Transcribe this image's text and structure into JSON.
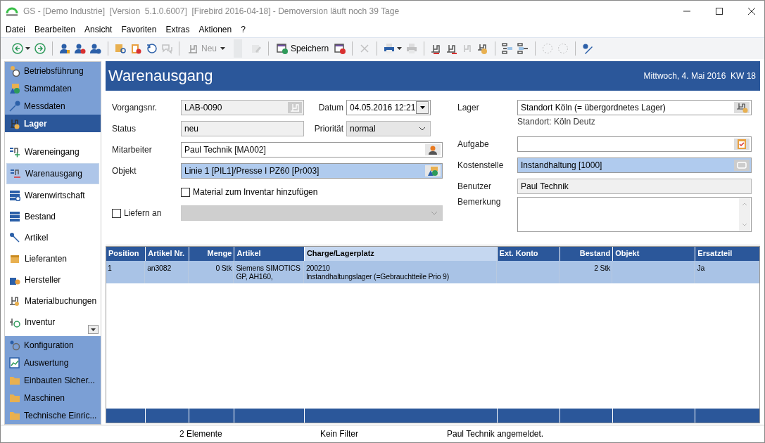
{
  "window": {
    "title": "GS - [Demo Industrie]  [Version  5.1.0.6007]  [Firebird 2016-04-18] - Demoversion läuft noch 39 Tage"
  },
  "menu": [
    "Datei",
    "Bearbeiten",
    "Ansicht",
    "Favoriten",
    "Extras",
    "Aktionen",
    "?"
  ],
  "toolbar": [
    {
      "kind": "icon",
      "disabled": false
    },
    {
      "kind": "caret",
      "disabled": false
    },
    {
      "kind": "icon",
      "disabled": false
    },
    {
      "kind": "separator"
    },
    {
      "kind": "icon",
      "disabled": false
    },
    {
      "kind": "icon",
      "disabled": false
    },
    {
      "kind": "icon",
      "disabled": false
    },
    {
      "kind": "separator"
    },
    {
      "kind": "icon",
      "disabled": false
    },
    {
      "kind": "icon",
      "disabled": false
    },
    {
      "kind": "icon",
      "disabled": false
    },
    {
      "kind": "icon",
      "disabled": true
    },
    {
      "kind": "separator"
    },
    {
      "kind": "button",
      "label": "Neu",
      "disabled": true
    },
    {
      "kind": "caret",
      "disabled": false
    },
    {
      "kind": "gap"
    },
    {
      "kind": "icon",
      "disabled": true
    },
    {
      "kind": "separator"
    },
    {
      "kind": "button",
      "label": "Speichern",
      "disabled": false
    },
    {
      "kind": "icon",
      "disabled": false
    },
    {
      "kind": "separator"
    },
    {
      "kind": "icon",
      "disabled": true
    },
    {
      "kind": "separator"
    },
    {
      "kind": "icon",
      "disabled": false
    },
    {
      "kind": "caret",
      "disabled": false
    },
    {
      "kind": "icon",
      "disabled": true
    },
    {
      "kind": "separator"
    },
    {
      "kind": "icon",
      "disabled": false
    },
    {
      "kind": "icon",
      "disabled": false
    },
    {
      "kind": "icon",
      "disabled": true
    },
    {
      "kind": "icon",
      "disabled": false
    },
    {
      "kind": "separator"
    },
    {
      "kind": "icon",
      "disabled": false
    },
    {
      "kind": "icon",
      "disabled": false
    },
    {
      "kind": "separator"
    },
    {
      "kind": "icon",
      "disabled": true
    },
    {
      "kind": "icon",
      "disabled": true
    },
    {
      "kind": "separator"
    },
    {
      "kind": "icon",
      "disabled": false
    }
  ],
  "sidebar": {
    "groups_top": [
      {
        "label": "Betriebsführung",
        "selected": false
      },
      {
        "label": "Stammdaten",
        "selected": false
      },
      {
        "label": "Messdaten",
        "selected": false
      },
      {
        "label": "Lager",
        "selected": true
      }
    ],
    "items": [
      {
        "label": "Wareneingang",
        "selected": false
      },
      {
        "label": "Warenausgang",
        "selected": true
      },
      {
        "label": "Warenwirtschaft",
        "selected": false
      },
      {
        "label": "Bestand",
        "selected": false
      },
      {
        "label": "Artikel",
        "selected": false
      },
      {
        "label": "Lieferanten",
        "selected": false
      },
      {
        "label": "Hersteller",
        "selected": false
      },
      {
        "label": "Materialbuchungen",
        "selected": false
      },
      {
        "label": "Inventur",
        "selected": false
      }
    ],
    "groups_bottom": [
      {
        "label": "Konfiguration",
        "selected": false
      },
      {
        "label": "Auswertung",
        "selected": false
      },
      {
        "label": "Einbauten Sicher...",
        "selected": false
      },
      {
        "label": "Maschinen",
        "selected": false
      },
      {
        "label": "Technische Einric...",
        "selected": false
      }
    ]
  },
  "header": {
    "title": "Warenausgang",
    "date": "Mittwoch, 4. Mai 2016  KW 18"
  },
  "form": {
    "vorgangsnr": {
      "label": "Vorgangsnr.",
      "value": "LAB-0090",
      "readonly": true,
      "highlighted": false
    },
    "datum": {
      "label": "Datum",
      "value": "04.05.2016 12:21"
    },
    "status": {
      "label": "Status",
      "value": "neu",
      "readonly": true,
      "highlighted": false
    },
    "prioritaet": {
      "label": "Priorität",
      "value": "normal"
    },
    "mitarbeiter": {
      "label": "Mitarbeiter",
      "value": "Paul Technik [MA002]",
      "readonly": false,
      "highlighted": false
    },
    "objekt": {
      "label": "Objekt",
      "value": "Linie 1 [PIL1]/Presse I PZ60 [Pr003]",
      "readonly": false,
      "highlighted": true
    },
    "material": {
      "label": "Material zum Inventar hinzufügen",
      "checked": false
    },
    "liefern": {
      "label": "Liefern an",
      "checked": false,
      "disabled": true
    },
    "lager": {
      "label": "Lager",
      "value": "Standort Köln (= übergordnetes Lager)",
      "readonly": false,
      "highlighted": false
    },
    "standort": "Standort: Köln Deutz",
    "aufgabe": {
      "label": "Aufgabe",
      "readonly": false,
      "highlighted": false
    },
    "kostenstelle": {
      "label": "Kostenstelle",
      "value": "Instandhaltung [1000]",
      "readonly": false,
      "highlighted": true
    },
    "benutzer": {
      "label": "Benutzer",
      "value": "Paul Technik",
      "readonly": true,
      "highlighted": false
    },
    "bemerkung": {
      "label": "Bemerkung"
    }
  },
  "table": {
    "columns": [
      {
        "label": "Position",
        "sorted": false
      },
      {
        "label": "Artikel Nr.",
        "sorted": false
      },
      {
        "label": "Menge",
        "sorted": false
      },
      {
        "label": "Artikel",
        "sorted": false
      },
      {
        "label": "Charge/Lagerplatz",
        "sorted": true
      },
      {
        "label": "Ext. Konto",
        "sorted": false
      },
      {
        "label": "Bestand",
        "sorted": false
      },
      {
        "label": "Objekt",
        "sorted": false
      },
      {
        "label": "Ersatzteil",
        "sorted": false
      }
    ],
    "rows": [
      {
        "selected": true,
        "cells": [
          "1",
          "an3082",
          "0 Stk",
          "Siemens SIMOTICS GP, AH160,",
          "200210\nInstandhaltungslager (=Gebrauchtteile Prio 9)",
          "",
          "2 Stk",
          "",
          "Ja"
        ]
      }
    ]
  },
  "status_bar": [
    "2 Elemente",
    "Kein Filter",
    "Paul Technik angemeldet."
  ]
}
